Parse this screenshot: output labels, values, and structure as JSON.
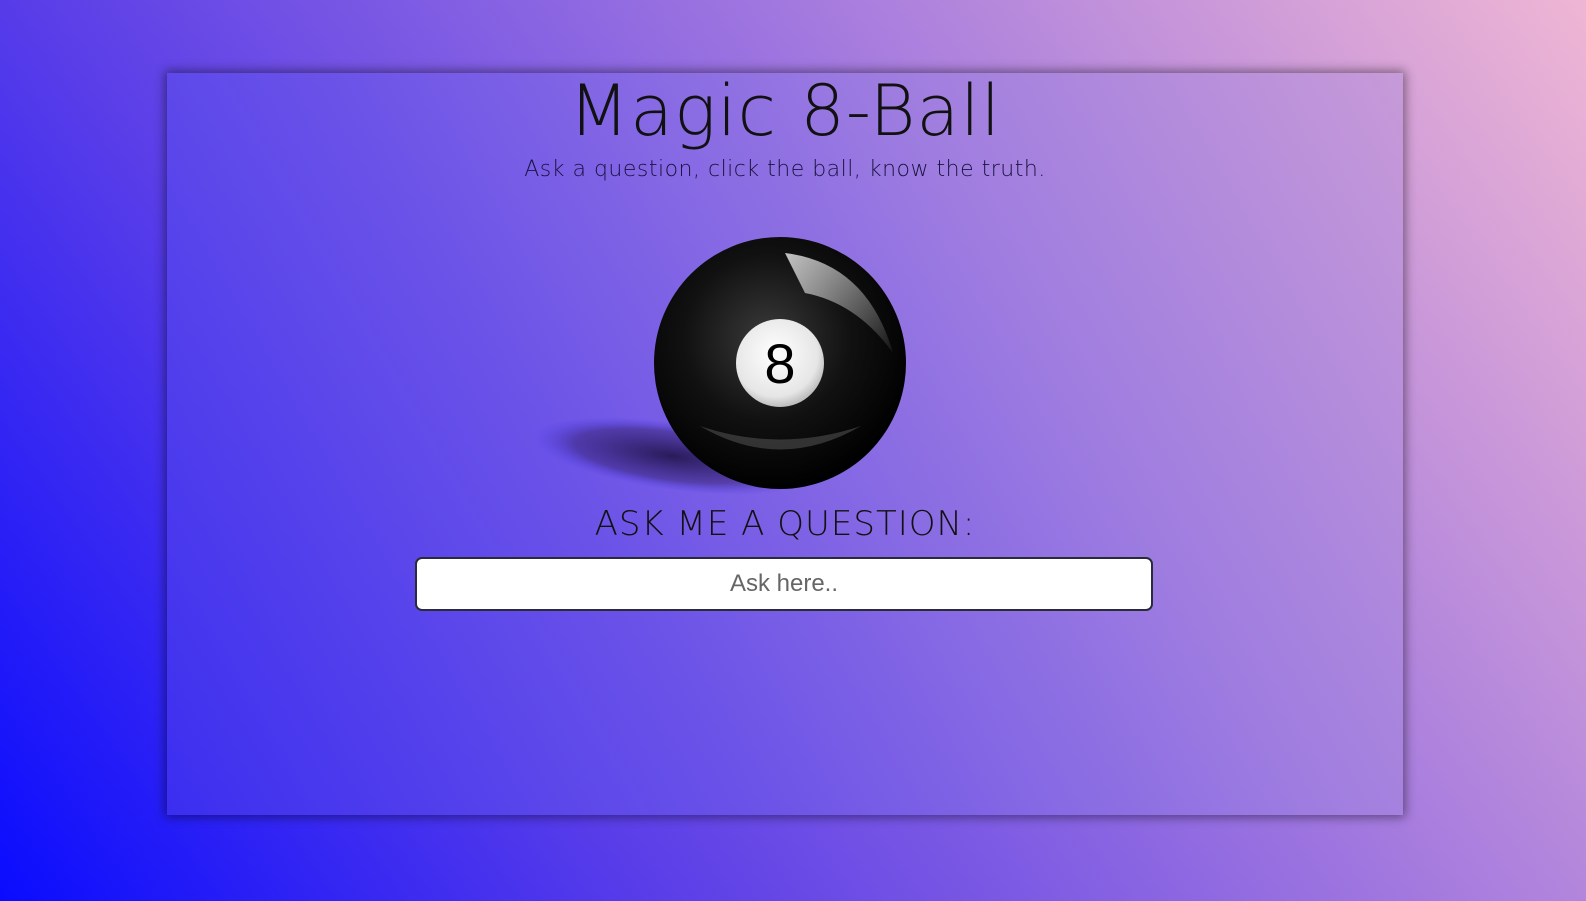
{
  "page": {
    "title": "Magic 8-Ball",
    "subtitle": "Ask a question, click the ball, know the truth."
  },
  "ball": {
    "number": "8",
    "icon": "eight-ball-icon"
  },
  "question": {
    "label": "ASK ME A QUESTION:",
    "placeholder": "Ask here..",
    "value": ""
  },
  "colors": {
    "background_start": "#0a0cff",
    "background_end": "#efb6d4",
    "ball": "#000000",
    "ball_window": "#ffffff"
  }
}
